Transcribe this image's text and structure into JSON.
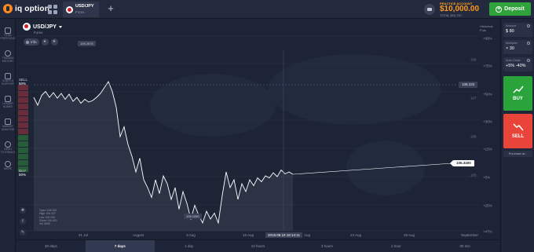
{
  "topbar": {
    "logo_text": "iq option",
    "tab": {
      "pair": "USD/JPY",
      "type": "Forex"
    },
    "balance": {
      "label": "PRACTICE ACCOUNT",
      "amount": "$10,000.00",
      "sub": "TOTAL $16,767"
    },
    "deposit_label": "Deposit"
  },
  "sidebar": {
    "items": [
      {
        "label": "TOTAL PORTFOLIO",
        "icon": "briefcase-icon"
      },
      {
        "label": "TRADING HISTORY",
        "icon": "history-icon"
      },
      {
        "label": "CHATS & SUPPORT",
        "icon": "chat-icon"
      },
      {
        "label": "LEADER BOARD",
        "icon": "trophy-icon"
      },
      {
        "label": "MARKET ANALYSIS",
        "icon": "news-icon"
      },
      {
        "label": "VIDEO TUTORIALS",
        "icon": "play-icon"
      },
      {
        "label": "MORE",
        "icon": "more-icon"
      }
    ]
  },
  "asset": {
    "pair": "USD/JPY",
    "type": "Forex",
    "info_label": "Info"
  },
  "historical_label": "Historical Puts",
  "sentiment": {
    "sell_label": "SELL",
    "sell_pct": "50%",
    "buy_label": "BUY",
    "buy_pct": "50%"
  },
  "ohlc": {
    "open": "Open 106.030",
    "high": "High 106.437",
    "low": "Low 106.030",
    "close": "Close 106.420",
    "vol": "Vol 4638"
  },
  "chart_data": {
    "type": "line",
    "x_ticks": [
      "21 Jul",
      "August",
      "9 Aug",
      "15 Aug",
      "Aug",
      "24 Aug",
      "28 Aug",
      "September"
    ],
    "y_ticks": [
      "108",
      "107",
      "106",
      "105"
    ],
    "pct_ticks": [
      "+99%",
      "+75%",
      "+50%",
      "+30%",
      "+15%",
      "+5%",
      "+25%",
      "+47%"
    ],
    "high_label": "109.2575",
    "low_label": "105.1050",
    "ref_price": "108.333",
    "current_price": "106.3400",
    "time_label": "2019.08.19 18:14:11",
    "series": [
      {
        "values": [
          108.3,
          108.1,
          108.35,
          108.45,
          108.3,
          108.42,
          108.28,
          108.4,
          108.25,
          108.38,
          108.2,
          108.3,
          108.15,
          108.25,
          108.18,
          108.22,
          108.3,
          108.4,
          108.55,
          108.7,
          108.45,
          108.05,
          107.3,
          107.55,
          107.1,
          106.8,
          106.4,
          106.75,
          106.2,
          106.0,
          105.75,
          106.2,
          105.85,
          106.3,
          106.1,
          105.7,
          106.0,
          105.45,
          105.9,
          105.6,
          105.2,
          105.55,
          105.3,
          105.1,
          105.4,
          105.2,
          105.35,
          105.1,
          105.8,
          106.4,
          106.0,
          106.2,
          105.7,
          106.1,
          105.9,
          106.2,
          106.05,
          106.25,
          106.15,
          106.3,
          106.25,
          106.38,
          106.28,
          106.45,
          106.35,
          106.4,
          106.34
        ]
      }
    ]
  },
  "timeframes": [
    "30 days",
    "7 days",
    "1 day",
    "12 hours",
    "3 hours",
    "1 hour",
    "30 min"
  ],
  "active_timeframe": "7 days",
  "right_panel": {
    "amount": {
      "label": "Amount",
      "value": "$ 80"
    },
    "multiplier": {
      "label": "Multiplier",
      "value": "× 30"
    },
    "auto_close": {
      "label": "Auto Close",
      "value": "+5% -40%"
    },
    "buy_label": "BUY",
    "sell_label": "SELL",
    "purchase_label": "Purchase at..."
  },
  "colors": {
    "buy": "#2aa43a",
    "sell": "#e8443a",
    "accent": "#ff9a1e",
    "line": "#ffffff"
  }
}
